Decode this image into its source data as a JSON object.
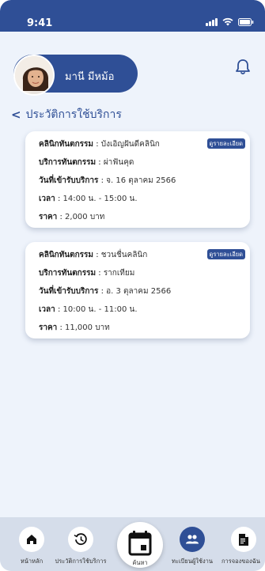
{
  "status_bar": {
    "time": "9:41"
  },
  "profile": {
    "name": "มานี มีหม้อ"
  },
  "section": {
    "title": "ประวัติการใช้บริการ"
  },
  "cards": [
    {
      "clinic_label": "คลินิกทันตกรรม",
      "clinic_value": "บังเอิญฝันดีคลินิก",
      "service_label": "บริการทันตกรรม",
      "service_value": "ผ่าฟันคุด",
      "date_label": "วันที่เข้ารับบริการ",
      "date_value": "จ. 16 ตุลาคม 2566",
      "time_label": "เวลา",
      "time_value": "14:00 น. - 15:00 น.",
      "price_label": "ราคา",
      "price_value": "2,000 บาท",
      "detail_label": "ดูรายละเอียด"
    },
    {
      "clinic_label": "คลินิกทันตกรรม",
      "clinic_value": "ชวนชื่นคลินิก",
      "service_label": "บริการทันตกรรม",
      "service_value": "รากเทียม",
      "date_label": "วันที่เข้ารับบริการ",
      "date_value": "อ. 3 ตุลาคม 2566",
      "time_label": "เวลา",
      "time_value": "10:00 น. - 11:00 น.",
      "price_label": "ราคา",
      "price_value": "11,000 บาท",
      "detail_label": "ดูรายละเอียด"
    }
  ],
  "nav": {
    "home": "หน้าหลัก",
    "history": "ประวัติการใช้บริการ",
    "search": "ค้นหา",
    "register": "ทะเบียนผู้ใช้งาน",
    "booking": "การจองของฉัน"
  },
  "colors": {
    "primary": "#2f4f96",
    "background": "#eef3fb",
    "nav_bg": "#d5ddea"
  }
}
